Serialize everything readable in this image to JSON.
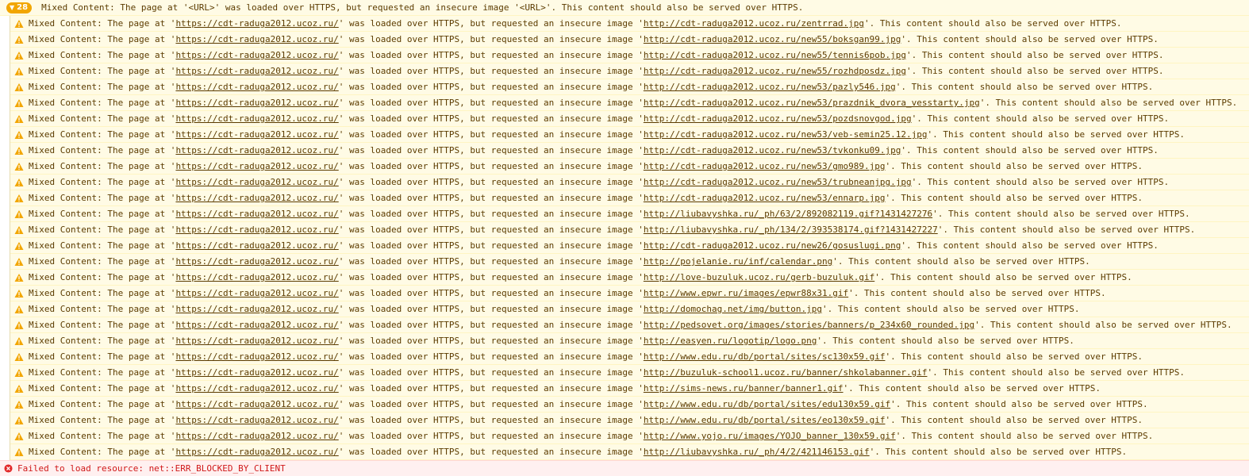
{
  "group": {
    "count": "28",
    "message": "Mixed Content: The page at '<URL>' was loaded over HTTPS, but requested an insecure image '<URL>'. This content should also be served over HTTPS."
  },
  "message_parts": {
    "prefix": "Mixed Content: The page at '",
    "middle": "' was loaded over HTTPS, but requested an insecure image '",
    "suffix": "'. This content should also be served over HTTPS."
  },
  "page_url": "https://cdt-raduga2012.ucoz.ru/",
  "insecure_images": [
    "http://cdt-raduga2012.ucoz.ru/zentrrad.jpg",
    "http://cdt-raduga2012.ucoz.ru/new55/boksgan99.jpg",
    "http://cdt-raduga2012.ucoz.ru/new55/tennis6pob.jpg",
    "http://cdt-raduga2012.ucoz.ru/new55/rozhdposdz.jpg",
    "http://cdt-raduga2012.ucoz.ru/new53/pazly546.jpg",
    "http://cdt-raduga2012.ucoz.ru/new53/prazdnik_dvora_vesstarty.jpg",
    "http://cdt-raduga2012.ucoz.ru/new53/pozdsnovgod.jpg",
    "http://cdt-raduga2012.ucoz.ru/new53/veb-semin25.12.jpg",
    "http://cdt-raduga2012.ucoz.ru/new53/tvkonku09.jpg",
    "http://cdt-raduga2012.ucoz.ru/new53/gmo989.jpg",
    "http://cdt-raduga2012.ucoz.ru/new53/trubneanjpg.jpg",
    "http://cdt-raduga2012.ucoz.ru/new53/ennarp.jpg",
    "http://liubavyshka.ru/_ph/63/2/892082119.gif?1431427276",
    "http://liubavyshka.ru/_ph/134/2/393538174.gif?1431427227",
    "http://cdt-raduga2012.ucoz.ru/new26/gosuslugi.png",
    "http://pojelanie.ru/inf/calendar.png",
    "http://love-buzuluk.ucoz.ru/gerb-buzuluk.gif",
    "http://www.epwr.ru/images/epwr88x31.gif",
    "http://domochag.net/img/button.jpg",
    "http://pedsovet.org/images/stories/banners/p_234x60_rounded.jpg",
    "http://easyen.ru/logotip/logo.png",
    "http://www.edu.ru/db/portal/sites/sc130x59.gif",
    "http://buzuluk-school1.ucoz.ru/banner/shkolabanner.gif",
    "http://sims-news.ru/banner/banner1.gif",
    "http://www.edu.ru/db/portal/sites/edu130x59.gif",
    "http://www.edu.ru/db/portal/sites/eo130x59.gif",
    "http://www.yojo.ru/images/YOJO_banner_130x59.gif",
    "http://liubavyshka.ru/_ph/4/2/421146153.gif"
  ],
  "error": {
    "message": "Failed to load resource: net::ERR_BLOCKED_BY_CLIENT"
  },
  "colors": {
    "warning_bg": "#fffbe5",
    "warning_text": "#5c3c00",
    "warning_icon": "#f2a600",
    "error_bg": "#fff0f0",
    "error_text": "#d01818"
  },
  "icons": {
    "group_toggle": "triangle-down-icon",
    "warning": "warning-triangle-icon",
    "error": "error-circle-icon"
  }
}
